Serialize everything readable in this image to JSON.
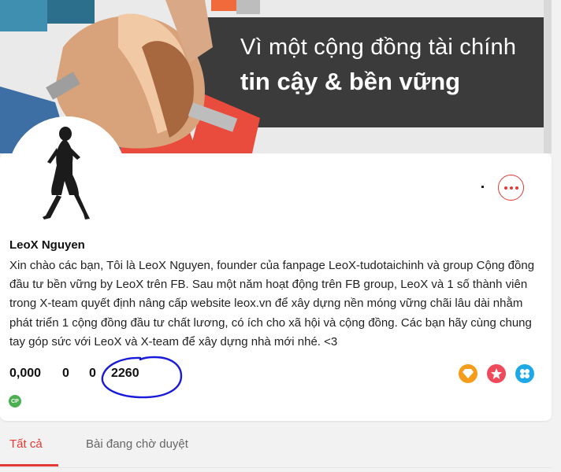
{
  "cover": {
    "title_line1": "Vì một cộng đồng tài chính",
    "title_line2": "tin cậy & bền vững"
  },
  "profile": {
    "name": "LeoX Nguyen",
    "bio": "Xin chào các bạn, Tôi là LeoX Nguyen, founder của fanpage LeoX-tudotaichinh và group Cộng đồng đầu tư bền vững by LeoX trên FB. Sau một năm hoạt động trên FB group, LeoX và 1 số thành viên trong X-team quyết định nâng cấp website leox.vn để xây dựng nền móng vững chãi lâu dài nhằm phát triển 1 cộng đồng đầu tư chất lương, có ích cho xã hội và cộng đồng. Các bạn hãy cùng chung tay góp sức với LeoX và X-team để xây dựng nhà mới nhé. <3",
    "stats": [
      "0,000",
      "0",
      "0",
      "2260"
    ],
    "cp_badge": "CP"
  },
  "icons": {
    "more": "more-dots-icon",
    "diamond": "diamond-icon",
    "star": "star-icon",
    "clover": "clover-icon"
  },
  "colors": {
    "accent": "#e53935",
    "badge_orange": "#f59c1a",
    "badge_red": "#ef4a5a",
    "badge_blue": "#1fa8e6",
    "badge_green": "#4caf50",
    "annotation": "#1a1adb"
  },
  "tabs": [
    {
      "label": "Tất cả",
      "active": true
    },
    {
      "label": "Bài đang chờ duyệt",
      "active": false
    }
  ]
}
